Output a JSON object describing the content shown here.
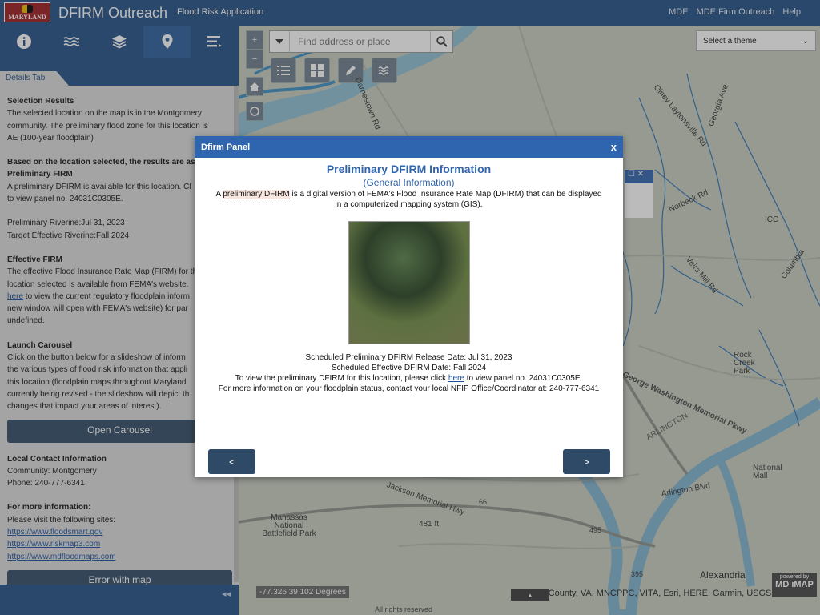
{
  "header": {
    "logo_text": "MARYLAND",
    "title": "DFIRM Outreach",
    "subtitle": "Flood Risk Application",
    "links": [
      "MDE",
      "MDE Firm Outreach",
      "Help"
    ]
  },
  "toolbar": {
    "icons": [
      "info-icon",
      "waves-icon",
      "layers-icon",
      "map-marker-icon",
      "list-icon"
    ],
    "active_index": 3
  },
  "panel": {
    "tab_label": "Details Tab",
    "selection_heading": "Selection Results",
    "selection_lines": [
      "The selected location on the map is in the Montgomery",
      "community. The preliminary flood zone for this location is",
      "AE (100-year floodplain)"
    ],
    "based_heading": "Based on the location selected, the results are as fol",
    "prelim_heading": "Preliminary FIRM",
    "prelim_lines": [
      "A preliminary DFIRM is available for this location. Cl",
      "to view panel no. 24031C0305E."
    ],
    "prelim_riverine": "Preliminary Riverine:Jul 31, 2023",
    "target_riverine": "Target Effective Riverine:Fall 2024",
    "effective_heading": "Effective FIRM",
    "effective_lines": [
      "The effective Flood Insurance Rate Map (FIRM) for th",
      "location selected is available from FEMA's website."
    ],
    "effective_link": "here",
    "effective_line_after_link": " to view the current regulatory floodplain inform",
    "effective_lines_2": [
      "new window will open with FEMA's website) for par",
      "undefined."
    ],
    "carousel_heading": "Launch Carousel",
    "carousel_lines": [
      "Click on the button below for a slideshow of inform",
      "the various types of flood risk information that appli",
      "this location (floodplain maps throughout Maryland",
      "currently being revised - the slideshow will depict th",
      "changes that impact your areas of interest)."
    ],
    "open_carousel_label": "Open Carousel",
    "contact_heading": "Local Contact Information",
    "community": "Community: Montgomery",
    "phone": "Phone: 240-777-6341",
    "more_heading": "For more information:",
    "more_line": "Please visit the following sites:",
    "links": [
      "https://www.floodsmart.gov",
      "https://www.riskmap3.com",
      "https://www.mdfloodmaps.com"
    ],
    "error_button_label": "Error with map"
  },
  "bottombar": {
    "collapse_symbol": "◂◂"
  },
  "map": {
    "search_placeholder": "Find address or place",
    "theme_placeholder": "Select a theme",
    "coords": "-77.326 39.102 Degrees",
    "attribution": "Fairfax County, VA, MNCPPC, VITA, Esri, HERE, Garmin, USGS, ...",
    "attribution_extra": "All rights reserved",
    "powered_by": "powered by",
    "powered_brand": "MD iMAP",
    "labels": {
      "rock_creek": "Rock Creek Park",
      "arlington": "ARLINGTON",
      "alexandria": "Alexandria",
      "national_mall": "National Mall",
      "manassas": "Manassas National Battlefield Park",
      "gw_memorial": "George Washington Memorial Pkwy",
      "arlington_blvd": "Arlington Blvd",
      "jackson_memorial": "Jackson Memorial Hwy",
      "darnestown_rd": "Darnestown Rd",
      "norbeck_rd": "Norbeck Rd",
      "olney_laytonsville": "Olney Laytonsville Rd",
      "veirs_mill": "Veirs Mill Rd",
      "georgia_ave": "Georgia Ave",
      "columbia": "Columbia",
      "icc": "ICC",
      "hwy_66": "66",
      "hwy_495": "495",
      "hwy_395": "395",
      "hwy_481": "481 ft"
    }
  },
  "modal": {
    "header": "Dfirm Panel",
    "close": "x",
    "title": "Preliminary DFIRM Information",
    "subtitle": "(General Information)",
    "desc_prefix": "A ",
    "desc_term": "preliminary DFIRM",
    "desc_suffix": " is a digital version of FEMA's Flood Insurance Rate Map (DFIRM) that can be displayed in a computerized mapping system (GIS).",
    "release": "Scheduled Preliminary DFIRM Release Date: Jul 31, 2023",
    "effective": "Scheduled Effective DFIRM Date: Fall 2024",
    "view_prefix": "To view the preliminary DFIRM for this location, please click ",
    "view_link": "here",
    "view_suffix": " to view panel no. 24031C0305E.",
    "contact": "For more information on your floodplain status, contact your local NFIP Office/Coordinator at: 240-777-6341",
    "prev_label": "<",
    "next_label": ">"
  }
}
